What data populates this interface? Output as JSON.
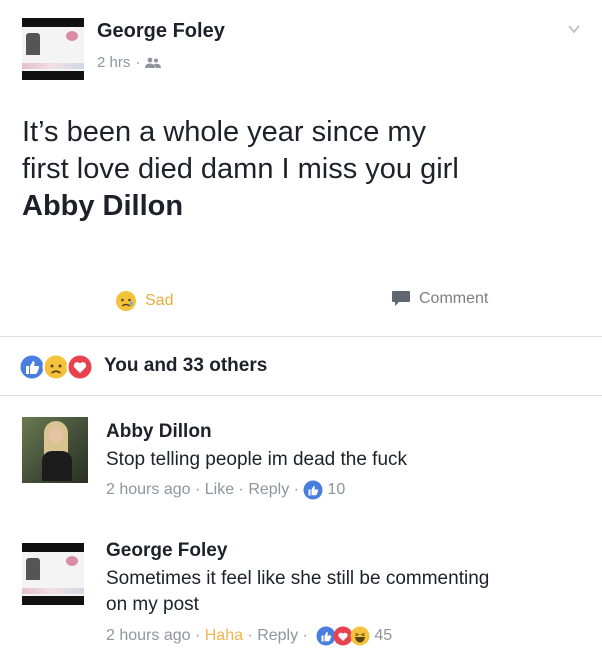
{
  "post": {
    "author": "George Foley",
    "time": "2 hrs",
    "separator": "·",
    "body_line1": "It’s been a whole year since my",
    "body_line2": "first love died damn I miss you girl",
    "tagged": "Abby Dillon"
  },
  "actions": {
    "reaction_label": "Sad",
    "comment_label": "Comment"
  },
  "reactions_summary": "You and 33 others",
  "comments": [
    {
      "author": "Abby Dillon",
      "text": "Stop telling people im dead the fuck",
      "time": "2 hours ago",
      "like": "Like",
      "reply": "Reply",
      "reaction_count": "10"
    },
    {
      "author": "George Foley",
      "text_line1": "Sometimes it feel like she still be commenting",
      "text_line2": "on my post",
      "time": "2 hours ago",
      "haha": "Haha",
      "reply": "Reply",
      "reaction_count": "45"
    }
  ],
  "colors": {
    "like_blue": "#4a7de0",
    "love_red": "#e9424f",
    "sad_yellow": "#f5c33b",
    "meta_gray": "#90949c"
  },
  "icons": [
    "chevron-down-icon",
    "audience-friends-icon",
    "sad-reaction-icon",
    "comment-icon",
    "like-reaction-icon",
    "love-reaction-icon",
    "haha-reaction-icon"
  ]
}
